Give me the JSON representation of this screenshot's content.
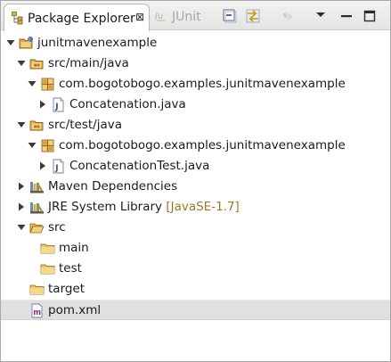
{
  "tabs": {
    "active_label": "Package Explorer",
    "close_glyph": "⊠",
    "inactive_label": "JUnit"
  },
  "tree": [
    {
      "label": "junitmavenexample",
      "icon": "project-icon",
      "arrow": "expanded"
    },
    {
      "label": "src/main/java",
      "icon": "source-folder-icon",
      "arrow": "expanded"
    },
    {
      "label": "com.bogotobogo.examples.junitmavenexample",
      "icon": "package-icon",
      "arrow": "expanded"
    },
    {
      "label": "Concatenation.java",
      "icon": "java-file-icon",
      "arrow": "collapsed"
    },
    {
      "label": "src/test/java",
      "icon": "source-folder-icon",
      "arrow": "expanded"
    },
    {
      "label": "com.bogotobogo.examples.junitmavenexample",
      "icon": "package-icon",
      "arrow": "expanded"
    },
    {
      "label": "ConcatenationTest.java",
      "icon": "java-file-icon",
      "arrow": "collapsed"
    },
    {
      "label": "Maven Dependencies",
      "icon": "library-icon",
      "arrow": "collapsed"
    },
    {
      "label": "JRE System Library",
      "decoration": "[JavaSE-1.7]",
      "icon": "library-icon",
      "arrow": "collapsed"
    },
    {
      "label": "src",
      "icon": "folder-open-icon",
      "arrow": "expanded"
    },
    {
      "label": "main",
      "icon": "folder-icon",
      "arrow": "none"
    },
    {
      "label": "test",
      "icon": "folder-icon",
      "arrow": "none"
    },
    {
      "label": "target",
      "icon": "folder-icon",
      "arrow": "none"
    },
    {
      "label": "pom.xml",
      "icon": "xml-file-icon",
      "arrow": "none",
      "selected": true
    }
  ],
  "colors": {
    "decoration": "#9a7a28",
    "selection": "#e0e0e0",
    "folder": "#e7b84a",
    "package": "#b5741f"
  }
}
